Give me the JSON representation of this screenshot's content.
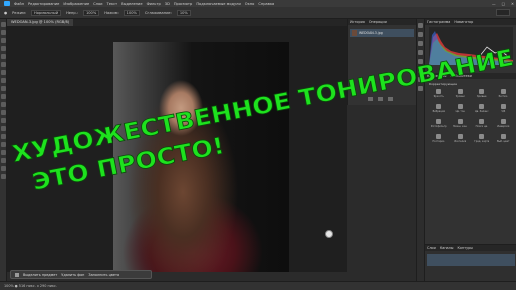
{
  "menubar": {
    "items": [
      "Файл",
      "Редактирование",
      "Изображение",
      "Слои",
      "Текст",
      "Выделение",
      "Фильтр",
      "3D",
      "Просмотр",
      "Подключаемые модули",
      "Окно",
      "Справка"
    ],
    "window_controls": [
      "—",
      "□",
      "✕"
    ]
  },
  "options": {
    "items": [
      "Режим:",
      "Нормальный",
      "Непр.:",
      "100%",
      "Нажим:",
      "100%",
      "Сглаживание:",
      "10%"
    ]
  },
  "document": {
    "tab_label": "WEDOAN-3.jpg @ 100% (RGB/8)"
  },
  "left_panel": {
    "tabs": [
      "История",
      "Операции"
    ],
    "history_item": "WEDOAN-3.jpg"
  },
  "right_panel": {
    "tabs": [
      "Гистограмма",
      "Навигатор"
    ],
    "sections": [
      "Коррекция",
      "Библиотеки"
    ],
    "adjust_title": "Корректирующие",
    "adjustments": [
      "Яркость",
      "Уровни",
      "Кривые",
      "Экспоз.",
      "Вибрация",
      "Цв. тон",
      "Цв. баланс",
      "Ч/Б",
      "Фотофильтр",
      "Микш. кан.",
      "Поиск цв.",
      "Инверсия",
      "Постериз.",
      "Изогелия",
      "Град. карта",
      "Выб. цвет"
    ],
    "layers_tabs": [
      "Слои",
      "Каналы",
      "Контуры"
    ]
  },
  "context_bar": {
    "items": [
      "Выделить предмет",
      "Удалить фон",
      "Заполнить цвета"
    ]
  },
  "status": {
    "text": "100% ● 516 пикс. x 290 пикс."
  },
  "overlay": {
    "line1": "ХУДОЖЕСТВЕННОЕ ТОНИРОВАНИЕ",
    "line2": "ЭТО ПРОСТО!",
    "color": "#1ee21e"
  }
}
